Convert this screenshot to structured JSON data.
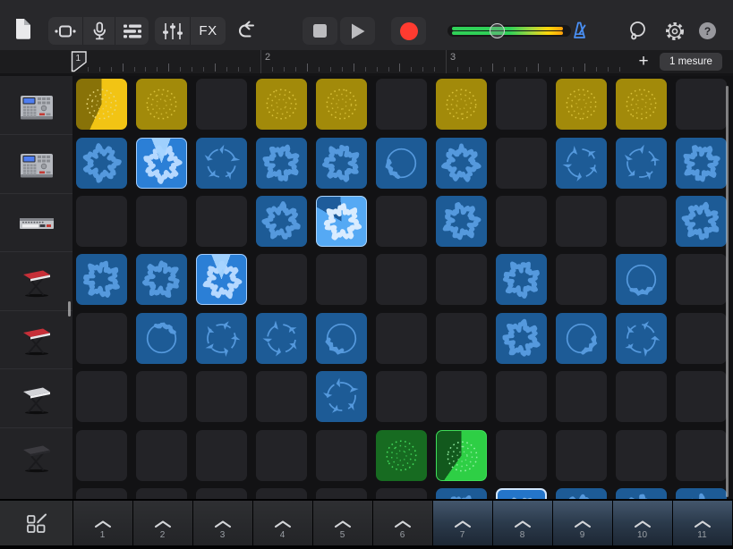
{
  "toolbar": {
    "fx_label": "FX",
    "help_label": "?",
    "colors": {
      "record_red": "#ff3b30",
      "metronome_blue": "#4a90f5",
      "level_meter_gradient": [
        "#30d158",
        "#ffd60a",
        "#ff9f0a"
      ],
      "button_background": "#333336"
    }
  },
  "ruler": {
    "playhead_label": "1",
    "measures": [
      "1",
      "2",
      "3"
    ],
    "add_loops_label": "+",
    "grid_length_label": "1 mesure"
  },
  "tracks": [
    {
      "icon": "drum-machine"
    },
    {
      "icon": "drum-machine"
    },
    {
      "icon": "synth-module"
    },
    {
      "icon": "keyboard-red"
    },
    {
      "icon": "keyboard-red"
    },
    {
      "icon": "keyboard-white"
    },
    {
      "icon": "keyboard-dark"
    }
  ],
  "grid": {
    "columns": 11,
    "colors": {
      "empty_cell": "#232327",
      "yellow_cell": "#a28a0a",
      "yellow_playing": "#f2c414",
      "blue_cell": "#1d5b96",
      "blue_playing": "#2b7fd6",
      "blue_playing_bright": "#55a9f4",
      "green_cell": "#176b21",
      "green_playing": "#2ecf45"
    },
    "rows": [
      {
        "color": "yellow",
        "cells": [
          "playing:dots",
          "filled:dots",
          "empty",
          "filled:dots",
          "filled:dots",
          "empty",
          "filled:dots",
          "empty",
          "filled:dots",
          "filled:dots",
          "empty"
        ]
      },
      {
        "color": "blue",
        "cells": [
          "filled:wave",
          "playing:wave",
          "filled:arrows",
          "filled:wave",
          "filled:wave",
          "filled:ring",
          "filled:wave",
          "empty",
          "filled:arrows",
          "filled:arrows",
          "filled:wave"
        ]
      },
      {
        "color": "blue",
        "cells": [
          "empty",
          "empty",
          "empty",
          "filled:wave",
          "playingbright:wave",
          "empty",
          "filled:wave",
          "empty",
          "empty",
          "empty",
          "filled:wave"
        ]
      },
      {
        "color": "blue",
        "cells": [
          "filled:wave",
          "filled:wave",
          "playing:wave",
          "empty",
          "empty",
          "empty",
          "empty",
          "filled:wave",
          "empty",
          "filled:ring",
          "empty"
        ]
      },
      {
        "color": "blue",
        "cells": [
          "empty",
          "filled:ring",
          "filled:arrows",
          "filled:arrows",
          "filled:ring",
          "empty",
          "empty",
          "filled:wave",
          "filled:ring",
          "filled:arrows",
          "empty"
        ]
      },
      {
        "color": "blue",
        "cells": [
          "empty",
          "empty",
          "empty",
          "empty",
          "filled:arrows",
          "empty",
          "empty",
          "empty",
          "empty",
          "empty",
          "empty"
        ]
      },
      {
        "color": "green",
        "cells": [
          "empty",
          "empty",
          "empty",
          "empty",
          "empty",
          "filled:dots",
          "playing:dots",
          "empty",
          "empty",
          "empty",
          "empty"
        ]
      },
      {
        "color": "blue",
        "cells": [
          "empty",
          "empty",
          "empty",
          "empty",
          "empty",
          "empty",
          "filled:wave",
          "selected:wave",
          "filled:wave",
          "filled:wave",
          "filled:wave"
        ]
      }
    ]
  },
  "trigger_bar": {
    "numbers": [
      "1",
      "2",
      "3",
      "4",
      "5",
      "6",
      "7",
      "8",
      "9",
      "10",
      "11"
    ],
    "highlight_start_column": 7
  }
}
